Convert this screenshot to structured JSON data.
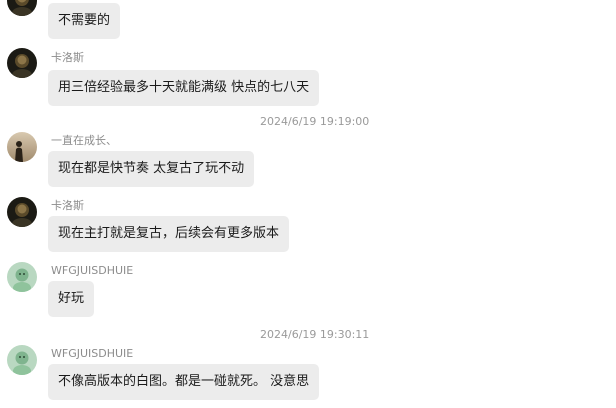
{
  "messages": [
    {
      "sender": "",
      "text": "不需要的",
      "avatar": "dark-portrait"
    },
    {
      "sender": "卡洛斯",
      "text": "用三倍经验最多十天就能满级 快点的七八天",
      "avatar": "dark-portrait"
    },
    {
      "timestamp": "2024/6/19 19:19:00"
    },
    {
      "sender": "一直在成长、",
      "text": "现在都是快节奏  太复古了玩不动",
      "avatar": "silhouette-sunset"
    },
    {
      "sender": "卡洛斯",
      "text": "现在主打就是复古，后续会有更多版本",
      "avatar": "dark-portrait"
    },
    {
      "sender": "WFGJUISDHUIE",
      "text": "好玩",
      "avatar": "green-cartoon"
    },
    {
      "timestamp": "2024/6/19 19:30:11"
    },
    {
      "sender": "WFGJUISDHUIE",
      "text": "不像高版本的白图。都是一碰就死。 没意思",
      "avatar": "green-cartoon"
    }
  ],
  "colors": {
    "bubble": "#ececec",
    "background": "#ffffff",
    "sender_text": "#8c8c8c",
    "timestamp_text": "#9a9a9a"
  }
}
